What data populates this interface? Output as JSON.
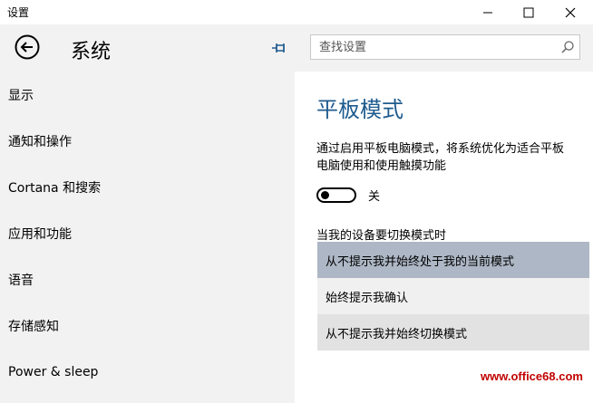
{
  "window": {
    "app_title": "设置",
    "controls": {
      "minimize_icon": "minimize-icon",
      "maximize_icon": "maximize-icon",
      "close_icon": "close-icon"
    }
  },
  "header": {
    "back_icon": "back-arrow-icon",
    "title": "系统",
    "pin_icon": "pin-icon",
    "search": {
      "value": "",
      "placeholder": "查找设置",
      "icon": "search-icon"
    }
  },
  "sidebar": {
    "items": [
      {
        "label": "显示"
      },
      {
        "label": "通知和操作"
      },
      {
        "label": "Cortana 和搜索"
      },
      {
        "label": "应用和功能"
      },
      {
        "label": "语音"
      },
      {
        "label": "存储感知"
      },
      {
        "label": "Power & sleep"
      }
    ]
  },
  "main": {
    "section_title": "平板模式",
    "description": "通过启用平板电脑模式，将系统优化为适合平板电脑使用和使用触摸功能",
    "toggle": {
      "state": "off",
      "label": "关"
    },
    "switch_prompt": {
      "label": "当我的设备要切换模式时",
      "options": [
        {
          "label": "从不提示我并始终处于我的当前模式",
          "selected": true
        },
        {
          "label": "始终提示我确认",
          "selected": false
        },
        {
          "label": "从不提示我并始终切换模式",
          "selected": false
        }
      ]
    }
  },
  "watermark": {
    "text": "www.office68.com"
  },
  "colors": {
    "accent": "#1e5b8e",
    "sidebar_bg": "#f2f2f2",
    "selected_option_bg": "#adb7c5"
  }
}
